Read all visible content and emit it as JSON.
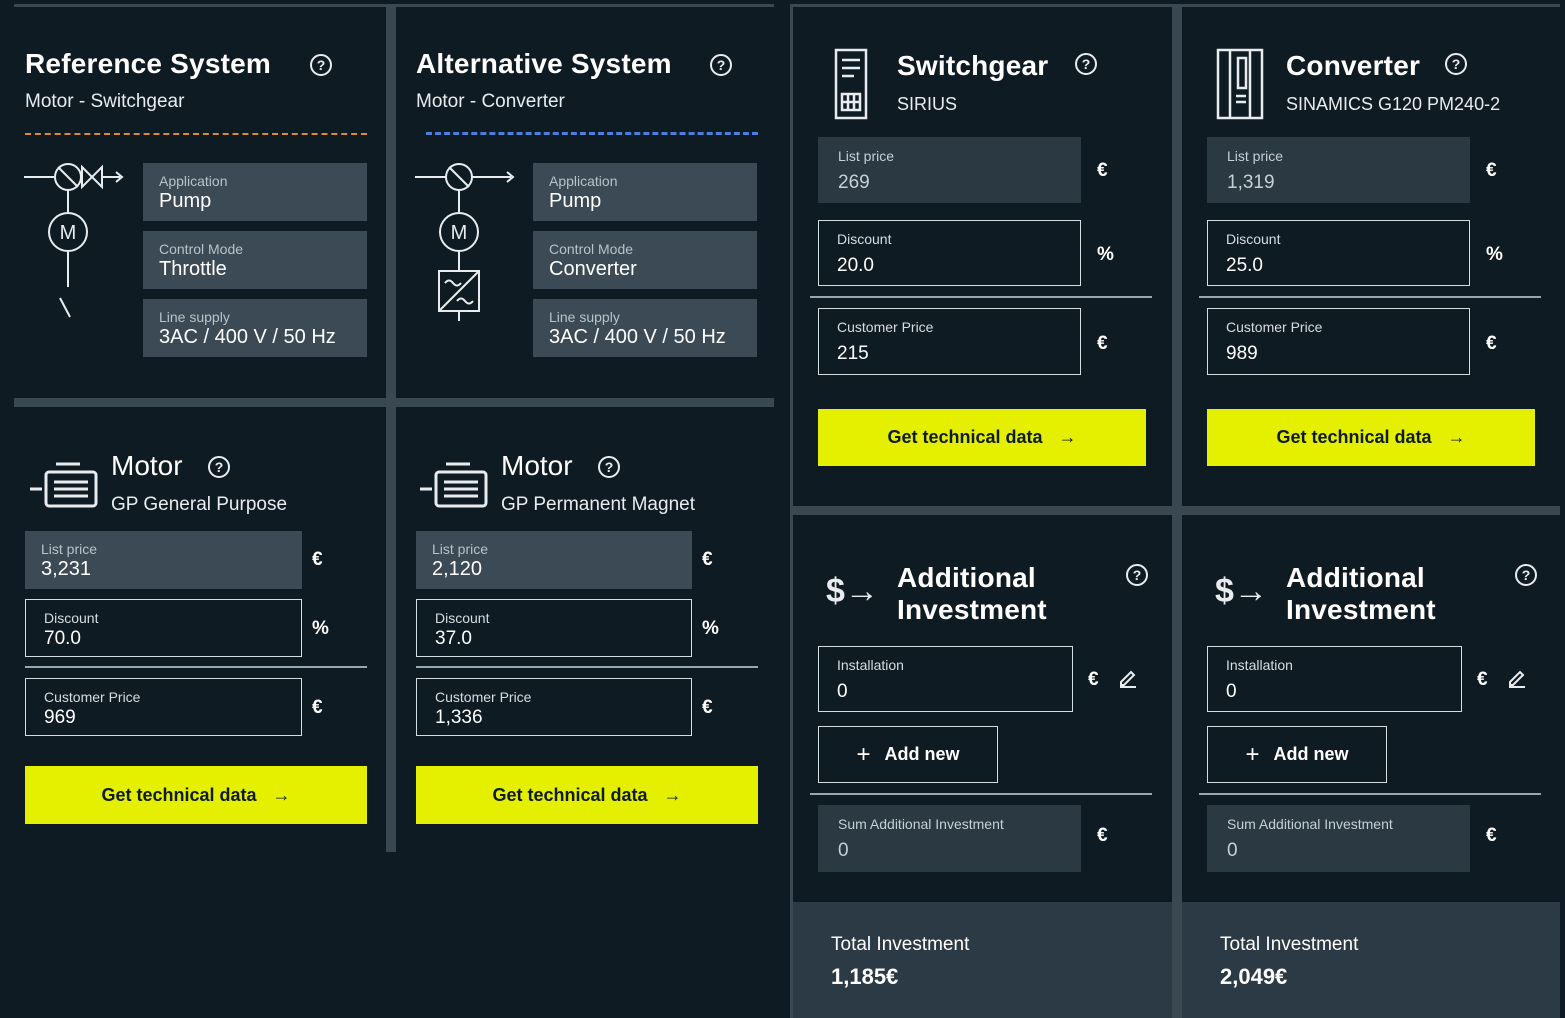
{
  "colors": {
    "background": "#0f1b22",
    "accent": "#e5ef00",
    "panel": "#3b4a54",
    "divider": "#3a4852"
  },
  "reference": {
    "title": "Reference System",
    "subtitle": "Motor - Switchgear",
    "application_label": "Application",
    "application_value": "Pump",
    "control_label": "Control Mode",
    "control_value": "Throttle",
    "supply_label": "Line supply",
    "supply_value": "3AC / 400 V / 50 Hz"
  },
  "alternative": {
    "title": "Alternative System",
    "subtitle": "Motor - Converter",
    "application_label": "Application",
    "application_value": "Pump",
    "control_label": "Control Mode",
    "control_value": "Converter",
    "supply_label": "Line supply",
    "supply_value": "3AC / 400 V / 50 Hz"
  },
  "motor_ref": {
    "title": "Motor",
    "subtitle": "GP General Purpose",
    "list_label": "List price",
    "list_value": "3,231",
    "list_unit": "€",
    "discount_label": "Discount",
    "discount_value": "70.0",
    "discount_unit": "%",
    "customer_label": "Customer Price",
    "customer_value": "969",
    "customer_unit": "€",
    "button": "Get technical data"
  },
  "motor_alt": {
    "title": "Motor",
    "subtitle": "GP Permanent Magnet",
    "list_label": "List price",
    "list_value": "2,120",
    "list_unit": "€",
    "discount_label": "Discount",
    "discount_value": "37.0",
    "discount_unit": "%",
    "customer_label": "Customer Price",
    "customer_value": "1,336",
    "customer_unit": "€",
    "button": "Get technical data"
  },
  "switchgear": {
    "title": "Switchgear",
    "subtitle": "SIRIUS",
    "list_label": "List price",
    "list_value": "269",
    "list_unit": "€",
    "discount_label": "Discount",
    "discount_value": "20.0",
    "discount_unit": "%",
    "customer_label": "Customer Price",
    "customer_value": "215",
    "customer_unit": "€",
    "button": "Get technical data"
  },
  "converter": {
    "title": "Converter",
    "subtitle": "SINAMICS G120 PM240-2",
    "list_label": "List price",
    "list_value": "1,319",
    "list_unit": "€",
    "discount_label": "Discount",
    "discount_value": "25.0",
    "discount_unit": "%",
    "customer_label": "Customer Price",
    "customer_value": "989",
    "customer_unit": "€",
    "button": "Get technical data"
  },
  "add_ref": {
    "title_line1": "Additional",
    "title_line2": "Investment",
    "installation_label": "Installation",
    "installation_value": "0",
    "installation_unit": "€",
    "add_new": "Add new",
    "sum_label": "Sum Additional Investment",
    "sum_value": "0",
    "sum_unit": "€"
  },
  "add_alt": {
    "title_line1": "Additional",
    "title_line2": "Investment",
    "installation_label": "Installation",
    "installation_value": "0",
    "installation_unit": "€",
    "add_new": "Add new",
    "sum_label": "Sum Additional Investment",
    "sum_value": "0",
    "sum_unit": "€"
  },
  "total_ref": {
    "label": "Total Investment",
    "value": "1,185€"
  },
  "total_alt": {
    "label": "Total Investment",
    "value": "2,049€"
  },
  "icons": {
    "help": "?",
    "arrow": "→",
    "plus": "+",
    "edit": "pencil-icon",
    "dollar": "$→"
  }
}
